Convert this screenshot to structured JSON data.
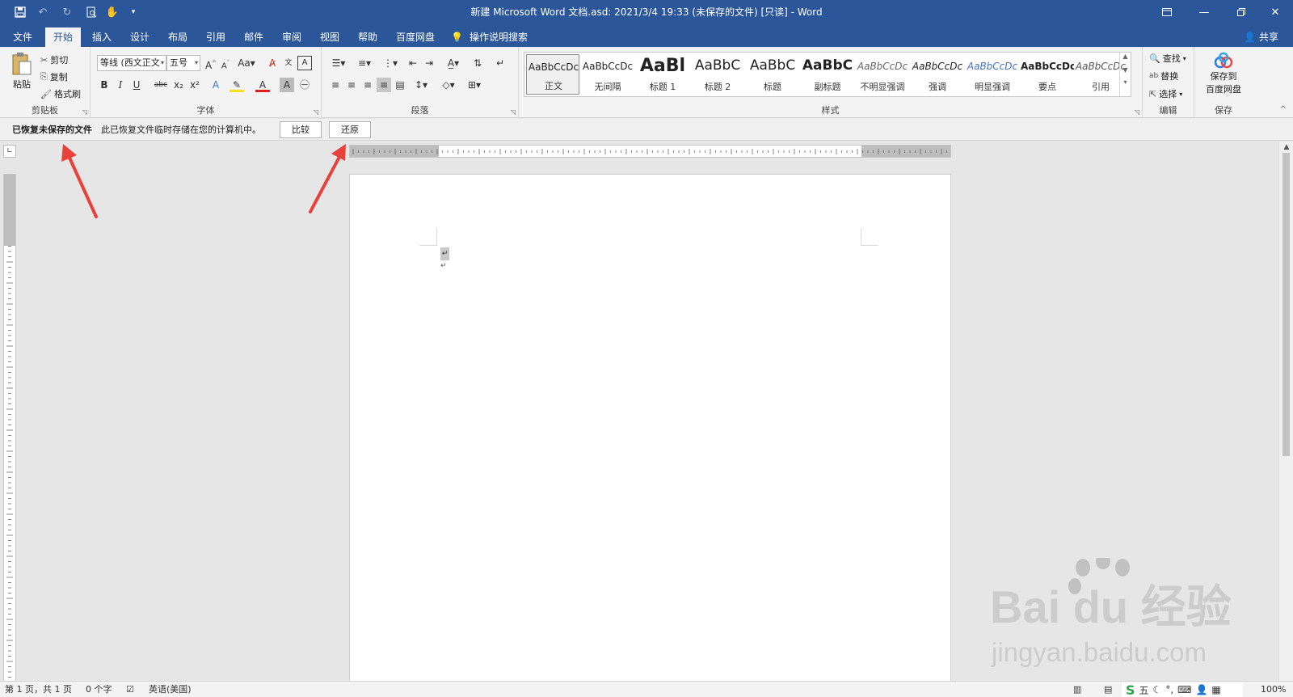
{
  "titlebar": {
    "title": "新建 Microsoft Word 文档.asd: 2021/3/4 19:33 (未保存的文件) [只读]  -  Word",
    "quick_access": [
      "save-icon",
      "undo-icon",
      "redo-icon",
      "print-preview-icon",
      "touch-mode-icon",
      "customize-icon"
    ],
    "window_controls": [
      "ribbon-display-icon",
      "minimize-icon",
      "restore-icon",
      "close-icon"
    ]
  },
  "tabs": {
    "items": [
      "文件",
      "开始",
      "插入",
      "设计",
      "布局",
      "引用",
      "邮件",
      "审阅",
      "视图",
      "帮助",
      "百度网盘"
    ],
    "active": "开始",
    "tell_me": "操作说明搜索",
    "share": "共享"
  },
  "ribbon": {
    "clipboard": {
      "label": "剪贴板",
      "paste": "粘贴",
      "cut": "剪切",
      "copy": "复制",
      "format_painter": "格式刷"
    },
    "font": {
      "label": "字体",
      "font_name": "等线 (西文正文",
      "font_size": "五号",
      "bold": "B",
      "italic": "I",
      "underline": "U",
      "strike": "abc",
      "sub": "x₂",
      "sup": "x²"
    },
    "paragraph": {
      "label": "段落"
    },
    "styles": {
      "label": "样式",
      "items": [
        {
          "sample": "AaBbCcDc",
          "name": "正文"
        },
        {
          "sample": "AaBbCcDc",
          "name": "无间隔"
        },
        {
          "sample": "AaBl",
          "name": "标题 1"
        },
        {
          "sample": "AaBbC",
          "name": "标题 2"
        },
        {
          "sample": "AaBbC",
          "name": "标题"
        },
        {
          "sample": "AaBbC",
          "name": "副标题"
        },
        {
          "sample": "AaBbCcDc",
          "name": "不明显强调"
        },
        {
          "sample": "AaBbCcDc",
          "name": "强调"
        },
        {
          "sample": "AaBbCcDc",
          "name": "明显强调"
        },
        {
          "sample": "AaBbCcDc",
          "name": "要点"
        },
        {
          "sample": "AaBbCcDc",
          "name": "引用"
        }
      ]
    },
    "editing": {
      "label": "编辑",
      "find": "查找",
      "replace": "替换",
      "select": "选择"
    },
    "save": {
      "label": "保存",
      "button_line1": "保存到",
      "button_line2": "百度网盘"
    }
  },
  "message_bar": {
    "title": "已恢复未保存的文件",
    "text": "此已恢复文件临时存储在您的计算机中。",
    "compare": "比较",
    "restore": "还原"
  },
  "status": {
    "page": "第 1 页，共 1 页",
    "words": "0 个字",
    "language": "英语(美国)",
    "zoom": "100%",
    "ime_char": "五"
  },
  "watermark": {
    "line1": "Bai du 经验",
    "line2": "jingyan.baidu.com"
  },
  "colors": {
    "title_blue": "#2b579a",
    "arrow_red": "#e8413a"
  }
}
